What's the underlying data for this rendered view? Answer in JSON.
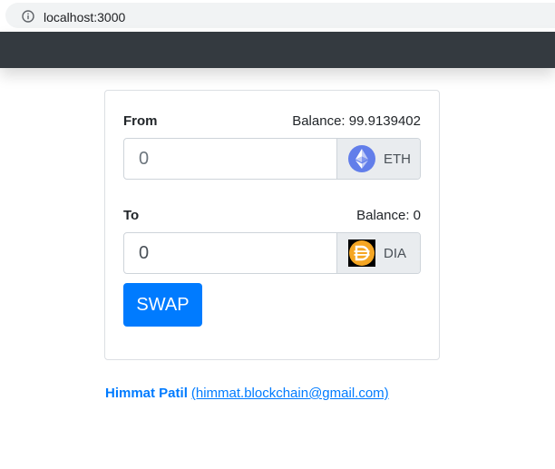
{
  "browser": {
    "url": "localhost:3000"
  },
  "from": {
    "label": "From",
    "balance": "Balance: 99.9139402",
    "amount_placeholder": "0",
    "token_symbol": "ETH"
  },
  "to": {
    "label": "To",
    "balance": "Balance: 0",
    "amount_value": "0",
    "token_symbol": "DIA"
  },
  "swap_button_label": "SWAP",
  "footer": {
    "author": "Himmat Patil",
    "email_link": "(himmat.blockchain@gmail.com)"
  },
  "colors": {
    "navbar": "#343a40",
    "primary": "#007bff",
    "eth_logo": "#627eea",
    "dia_logo": "#f5a623"
  },
  "icons": {
    "address_bar": "info-icon",
    "from_token": "ethereum-logo-icon",
    "to_token": "dia-logo-icon"
  }
}
